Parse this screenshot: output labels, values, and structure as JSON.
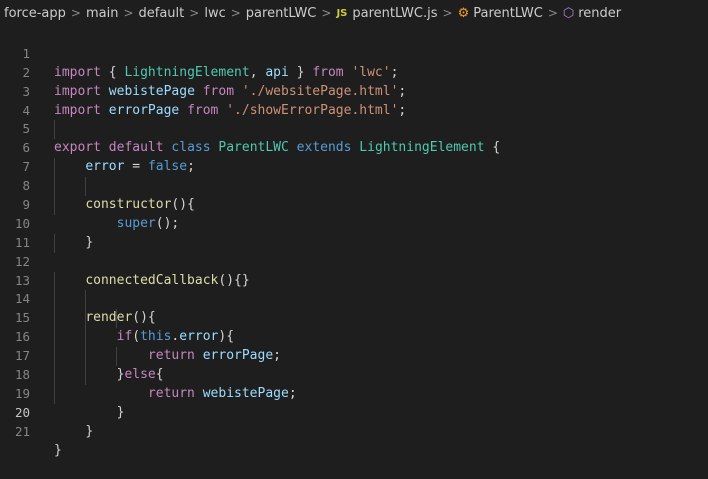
{
  "breadcrumb": {
    "items": [
      "force-app",
      "main",
      "default",
      "lwc",
      "parentLWC",
      "parentLWC.js",
      "ParentLWC",
      "render"
    ],
    "separator": ">",
    "file_icon_label": "JS"
  },
  "editor": {
    "active_line": 20,
    "line_numbers": [
      "1",
      "2",
      "3",
      "4",
      "5",
      "6",
      "7",
      "8",
      "9",
      "10",
      "11",
      "12",
      "13",
      "14",
      "15",
      "16",
      "17",
      "18",
      "19",
      "20",
      "21"
    ],
    "lines": [
      "import { LightningElement, api } from 'lwc';",
      "import webistePage from './websitePage.html';",
      "import errorPage from './showErrorPage.html';",
      "",
      "export default class ParentLWC extends LightningElement {",
      "    error = false;",
      "",
      "    constructor(){",
      "        super();",
      "    }",
      "",
      "    connectedCallback(){}",
      "",
      "    render(){",
      "        if(this.error){",
      "            return errorPage;",
      "        }else{",
      "            return webistePage;",
      "        }",
      "    }",
      "}"
    ]
  },
  "colors": {
    "background": "#1e1e1e",
    "keyword": "#569cd6",
    "control": "#c586c0",
    "string": "#ce9178",
    "variable": "#9cdcfe",
    "class": "#4ec9b0",
    "function": "#dcdcaa"
  }
}
